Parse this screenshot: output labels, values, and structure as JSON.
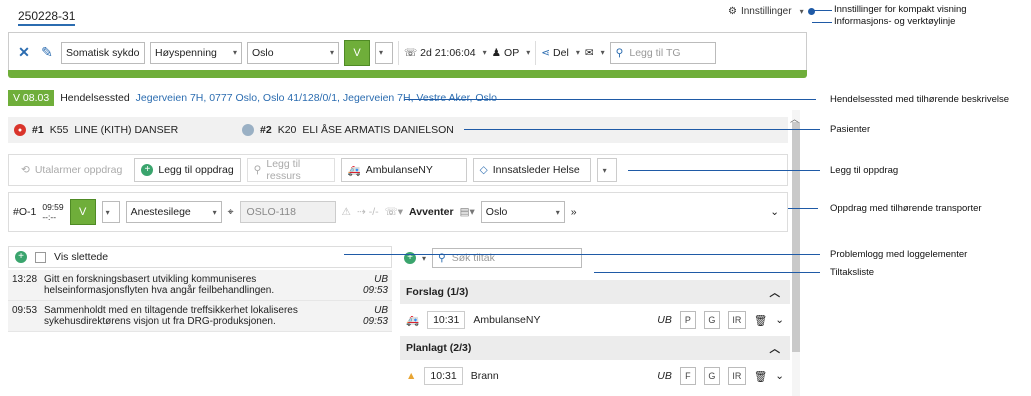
{
  "case_id": "250228-31",
  "settings": {
    "label": "Innstillinger"
  },
  "toolbar": {
    "category": "Somatisk sykdo",
    "priority": "Høyspenning",
    "location": "Oslo",
    "v_label": "V",
    "timer": "2d 21:06:04",
    "op": "OP",
    "share": "Del",
    "search_placeholder": "Legg til TG"
  },
  "event": {
    "badge": "V 08.03",
    "label": "Hendelsessted",
    "address": "Jegerveien 7H, 0777 Oslo, Oslo 41/128/0/1, Jegerveien 7H, Vestre Aker, Oslo"
  },
  "patients": [
    {
      "num": "#1",
      "code": "K55",
      "name": "LINE (KITH) DANSER"
    },
    {
      "num": "#2",
      "code": "K20",
      "name": "ELI ÅSE ARMATIS DANIELSON"
    }
  ],
  "add_row": {
    "unalarm": "Utalarmer oppdrag",
    "add": "Legg til oppdrag",
    "resource_placeholder": "Legg til ressurs",
    "ambulance": "AmbulanseNY",
    "leader": "Innsatsleder Helse"
  },
  "mission": {
    "id": "#O-1",
    "time": "09:59",
    "subtime": "--:--",
    "v_label": "V",
    "role": "Anestesilege",
    "unit": "OSLO-118",
    "eta": "-/-",
    "status": "Avventer",
    "location": "Oslo",
    "more": "»"
  },
  "log": {
    "show_deleted": "Vis slettede",
    "items": [
      {
        "time": "13:28",
        "text": "Gitt en forskningsbasert utvikling kommuniseres helseinformasjonsflyten hva angår feilbehandlingen.",
        "user": "UB 09:53"
      },
      {
        "time": "09:53",
        "text": "Sammenholdt med en tiltagende treffsikkerhet lokaliseres sykehusdirektørens visjon ut fra DRG-produksjonen.",
        "user": "UB 09:53"
      }
    ]
  },
  "tiltak": {
    "search_placeholder": "Søk tiltak",
    "sections": [
      {
        "title": "Forslag (1/3)",
        "time": "10:31",
        "name": "AmbulanseNY",
        "user": "UB",
        "chips": [
          "P",
          "G",
          "IR"
        ]
      },
      {
        "title": "Planlagt (2/3)",
        "time": "10:31",
        "name": "Brann",
        "user": "UB",
        "chips": [
          "F",
          "G",
          "IR"
        ]
      }
    ]
  },
  "annotations": {
    "a1": "Innstillinger for kompakt visning",
    "a2": "Informasjons- og verktøylinje",
    "a3": "Hendelsessted med tilhørende beskrivelse",
    "a4": "Pasienter",
    "a5": "Legg til oppdrag",
    "a6": "Oppdrag med tilhørende transporter",
    "a7": "Problemlogg med loggelementer",
    "a8": "Tiltaksliste"
  },
  "colors": {
    "accent_green": "#6fae3a",
    "link_blue": "#2b6cb0",
    "annotation_blue": "#1f5aa6",
    "alert_red": "#d9342b"
  }
}
